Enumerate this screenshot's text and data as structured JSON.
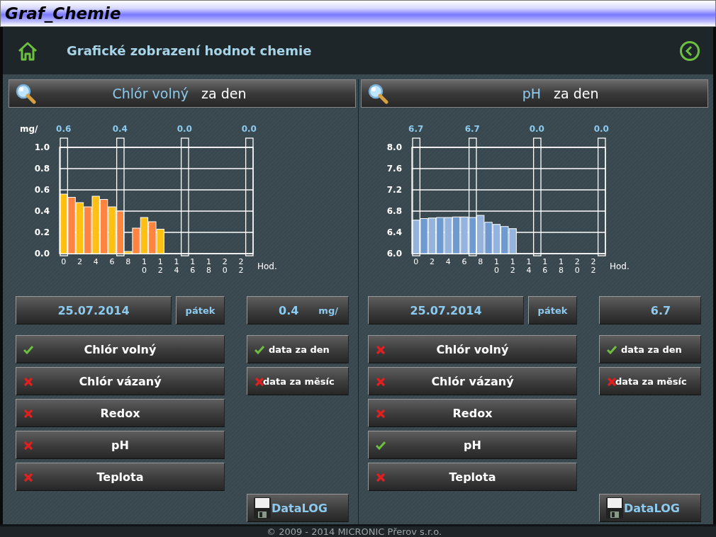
{
  "window": {
    "title": "Graf_Chemie"
  },
  "header": {
    "title": "Grafické zobrazení hodnot chemie"
  },
  "panels": [
    {
      "heading": {
        "quantity": "Chlór volný",
        "period": "za den"
      },
      "cursors": [
        "0.6",
        "0.4",
        "0.0",
        "0.0"
      ],
      "chart_data": {
        "type": "bar",
        "ylabel": "mg/",
        "xlabel": "Hod.",
        "grid": true,
        "x": [
          0,
          1,
          2,
          3,
          4,
          5,
          6,
          7,
          8,
          9,
          10,
          11,
          12
        ],
        "series": [
          {
            "color": "#ffc012",
            "values": [
              0.56,
              null,
              0.48,
              null,
              0.54,
              null,
              0.44,
              null,
              0.02,
              null,
              0.34,
              null,
              0.23
            ]
          },
          {
            "color": "#ff8440",
            "values": [
              null,
              0.53,
              null,
              0.44,
              null,
              0.51,
              null,
              0.4,
              null,
              0.24,
              null,
              0.3,
              null
            ]
          }
        ],
        "xlim": [
          -0.5,
          23.5
        ],
        "ylim": [
          0,
          1
        ],
        "yticks": [
          {
            "value": 0,
            "label": "0.0"
          },
          {
            "value": 0.2,
            "label": "0.2"
          },
          {
            "value": 0.4,
            "label": "0.4"
          },
          {
            "value": 0.6,
            "label": "0.6"
          },
          {
            "value": 0.8,
            "label": "0.8"
          },
          {
            "value": 1,
            "label": "1.0"
          }
        ],
        "xticks": [
          0,
          2,
          4,
          6,
          8,
          10,
          12,
          14,
          16,
          18,
          20,
          22
        ]
      },
      "date": "25.07.2014",
      "weekday": "pátek",
      "value": "0.4",
      "unit": "mg/",
      "parameters": [
        {
          "label": "Chlór volný",
          "checked": true
        },
        {
          "label": "Chlór vázaný",
          "checked": false
        },
        {
          "label": "Redox",
          "checked": false
        },
        {
          "label": "pH",
          "checked": false
        },
        {
          "label": "Teplota",
          "checked": false
        }
      ],
      "ranges": [
        {
          "label": "data za den",
          "checked": true
        },
        {
          "label": "data za měsíc",
          "checked": false
        }
      ],
      "datalog": "DataLOG"
    },
    {
      "heading": {
        "quantity": "pH",
        "period": "za den"
      },
      "cursors": [
        "6.7",
        "6.7",
        "0.0",
        "0.0"
      ],
      "chart_data": {
        "type": "bar",
        "xlabel": "Hod.",
        "grid": true,
        "x": [
          0,
          1,
          2,
          3,
          4,
          5,
          6,
          7,
          8,
          9,
          10,
          11,
          12
        ],
        "series": [
          {
            "color": "#94b4de",
            "values": [
              6.63,
              null,
              6.67,
              null,
              6.68,
              null,
              6.69,
              null,
              6.72,
              null,
              6.55,
              null,
              6.47
            ]
          },
          {
            "color": "#6e9acf",
            "values": [
              null,
              6.66,
              null,
              6.68,
              null,
              6.69,
              null,
              6.68,
              null,
              6.59,
              null,
              6.51,
              null
            ]
          }
        ],
        "xlim": [
          -0.5,
          23.5
        ],
        "ylim": [
          6,
          8
        ],
        "yticks": [
          {
            "value": 6,
            "label": "6.0"
          },
          {
            "value": 6.4,
            "label": "6.4"
          },
          {
            "value": 6.8,
            "label": "6.8"
          },
          {
            "value": 7.2,
            "label": "7.2"
          },
          {
            "value": 7.6,
            "label": "7.6"
          },
          {
            "value": 8,
            "label": "8.0"
          }
        ],
        "xticks": [
          0,
          2,
          4,
          6,
          8,
          10,
          12,
          14,
          16,
          18,
          20,
          22
        ]
      },
      "date": "25.07.2014",
      "weekday": "pátek",
      "value": "6.7",
      "parameters": [
        {
          "label": "Chlór volný",
          "checked": false
        },
        {
          "label": "Chlór vázaný",
          "checked": false
        },
        {
          "label": "Redox",
          "checked": false
        },
        {
          "label": "pH",
          "checked": true
        },
        {
          "label": "Teplota",
          "checked": false
        }
      ],
      "ranges": [
        {
          "label": "data za den",
          "checked": true
        },
        {
          "label": "data za měsíc",
          "checked": false
        }
      ],
      "datalog": "DataLOG"
    }
  ],
  "footer": "© 2009 - 2014 MICRONIC Přerov s.r.o."
}
